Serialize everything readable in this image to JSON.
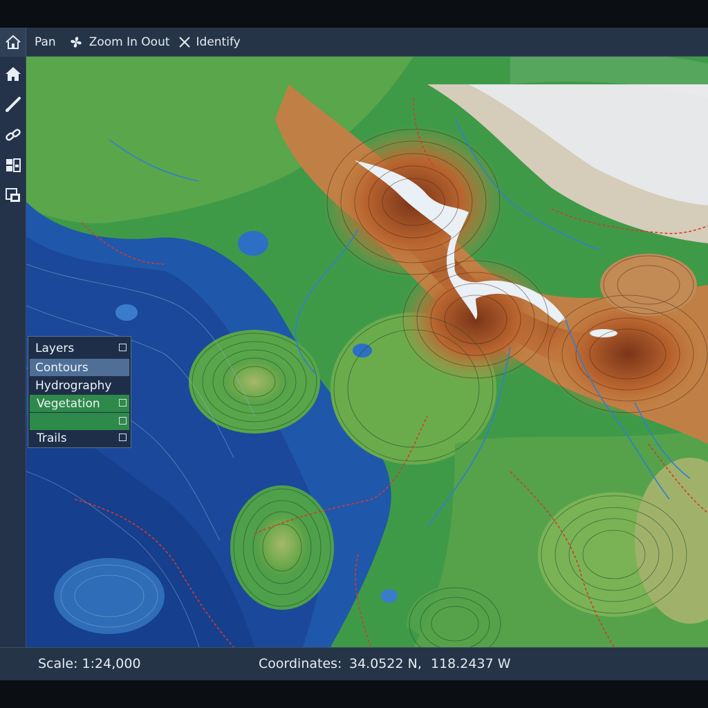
{
  "toolbar": {
    "pan_label": "Pan",
    "zoom_label": "Zoom In Oout",
    "identify_label": "Identify"
  },
  "sidebar": {
    "items": [
      {
        "icon": "home-icon"
      },
      {
        "icon": "measure-icon"
      },
      {
        "icon": "link-icon"
      },
      {
        "icon": "layout-icon"
      },
      {
        "icon": "windows-icon"
      }
    ]
  },
  "layers_panel": {
    "title": "Layers",
    "items": [
      {
        "label": "Contours",
        "selected": true
      },
      {
        "label": "Hydrography",
        "selected": false
      },
      {
        "label": "Vegetation",
        "selected": false
      },
      {
        "label": "",
        "selected": false
      },
      {
        "label": "Trails",
        "selected": false
      }
    ]
  },
  "status": {
    "scale": "Scale: 1:24,000",
    "coordinates_label": "Coordinates:",
    "lat": "34.0522 N,",
    "lon": "118.2437 W"
  },
  "colors": {
    "toolbar_bg": "#263447",
    "deep_water": "#1d4fa0",
    "water": "#2f6fc0",
    "lowland": "#3e9a45",
    "midland": "#7bb04a",
    "highland": "#b86b35",
    "peak": "#8a3e22",
    "snow": "#dfe6ee",
    "trail": "#d0332a",
    "contour_green": "#1d5a2a",
    "contour_brown": "#4a2412",
    "selected_row": "#4f6f97",
    "vegetation_row": "#2e8a4a"
  }
}
